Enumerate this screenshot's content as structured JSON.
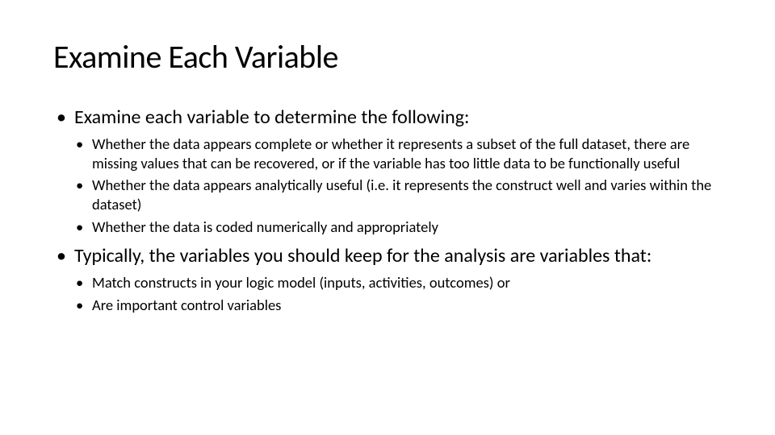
{
  "title": "Examine Each Variable",
  "bullets": [
    {
      "text": "Examine each variable to determine the following:",
      "sub": [
        "Whether the data appears complete or whether it represents a subset of the full dataset, there are missing values that can be recovered, or if the variable has too little data to be functionally useful",
        "Whether the data appears analytically useful (i.e. it represents the construct well and varies within the dataset)",
        "Whether the data is coded numerically and appropriately"
      ]
    },
    {
      "text": "Typically, the variables you should keep for the analysis are variables that:",
      "sub": [
        "Match constructs in your logic model (inputs, activities, outcomes) or",
        "Are important control variables"
      ]
    }
  ]
}
